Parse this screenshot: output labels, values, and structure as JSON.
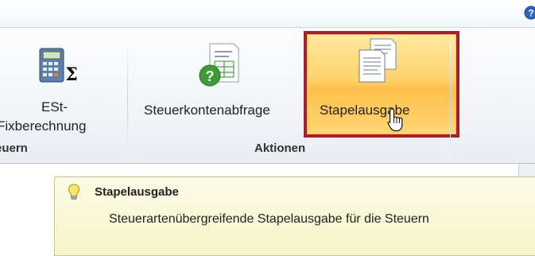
{
  "ribbon": {
    "est_button": {
      "line1": "ESt-",
      "line2": "Fixberechnung",
      "icon": "calculator-sum-icon"
    },
    "left_group_label": "euern",
    "steuerkonten_button": {
      "label": "Steuerkontenabfrage",
      "icon": "document-question-icon"
    },
    "stapel_button": {
      "label": "Stapelausgabe",
      "icon": "document-stack-icon"
    },
    "actions_group_label": "Aktionen"
  },
  "tooltip": {
    "title": "Stapelausgabe",
    "description": "Steuerartenübergreifende Stapelausgabe für die Steuern",
    "icon": "lightbulb-icon"
  },
  "colors": {
    "highlight_border": "#a3202f",
    "hover_gradient_top": "#ffe9a0",
    "hover_gradient_bottom": "#ffc04a",
    "tooltip_bg": "#fbfbe6"
  }
}
